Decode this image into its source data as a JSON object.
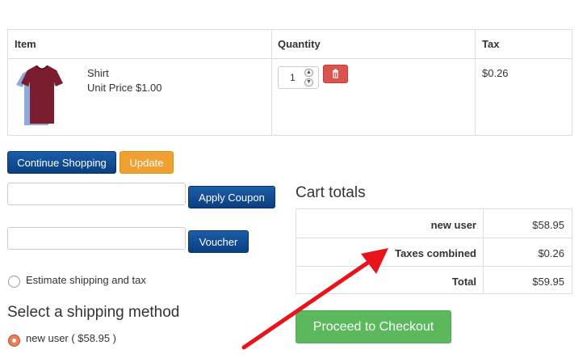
{
  "cart": {
    "headers": {
      "item": "Item",
      "quantity": "Quantity",
      "tax": "Tax"
    },
    "item": {
      "name": "Shirt",
      "unit_price": "Unit Price $1.00",
      "image_icon": "tshirt-image",
      "quantity": "1",
      "tax": "$0.26"
    }
  },
  "actions": {
    "continue_shopping": "Continue Shopping",
    "update": "Update",
    "apply_coupon": "Apply Coupon",
    "voucher": "Voucher",
    "coupon_placeholder": "",
    "voucher_placeholder": ""
  },
  "estimate": {
    "label": "Estimate shipping and tax"
  },
  "shipping": {
    "title": "Select a shipping method",
    "option": "new user ( $58.95 )"
  },
  "totals": {
    "title": "Cart totals",
    "rows": [
      {
        "label": "new user",
        "value": "$58.95"
      },
      {
        "label": "Taxes combined",
        "value": "$0.26"
      },
      {
        "label": "Total",
        "value": "$59.95"
      }
    ]
  },
  "checkout": {
    "label": "Proceed to Checkout"
  },
  "colors": {
    "primary_button": "#0a3f82",
    "update_button": "#f0a030",
    "checkout_button": "#5cb85c",
    "delete_button": "#d9534f",
    "annotation_arrow": "#e8141b"
  }
}
